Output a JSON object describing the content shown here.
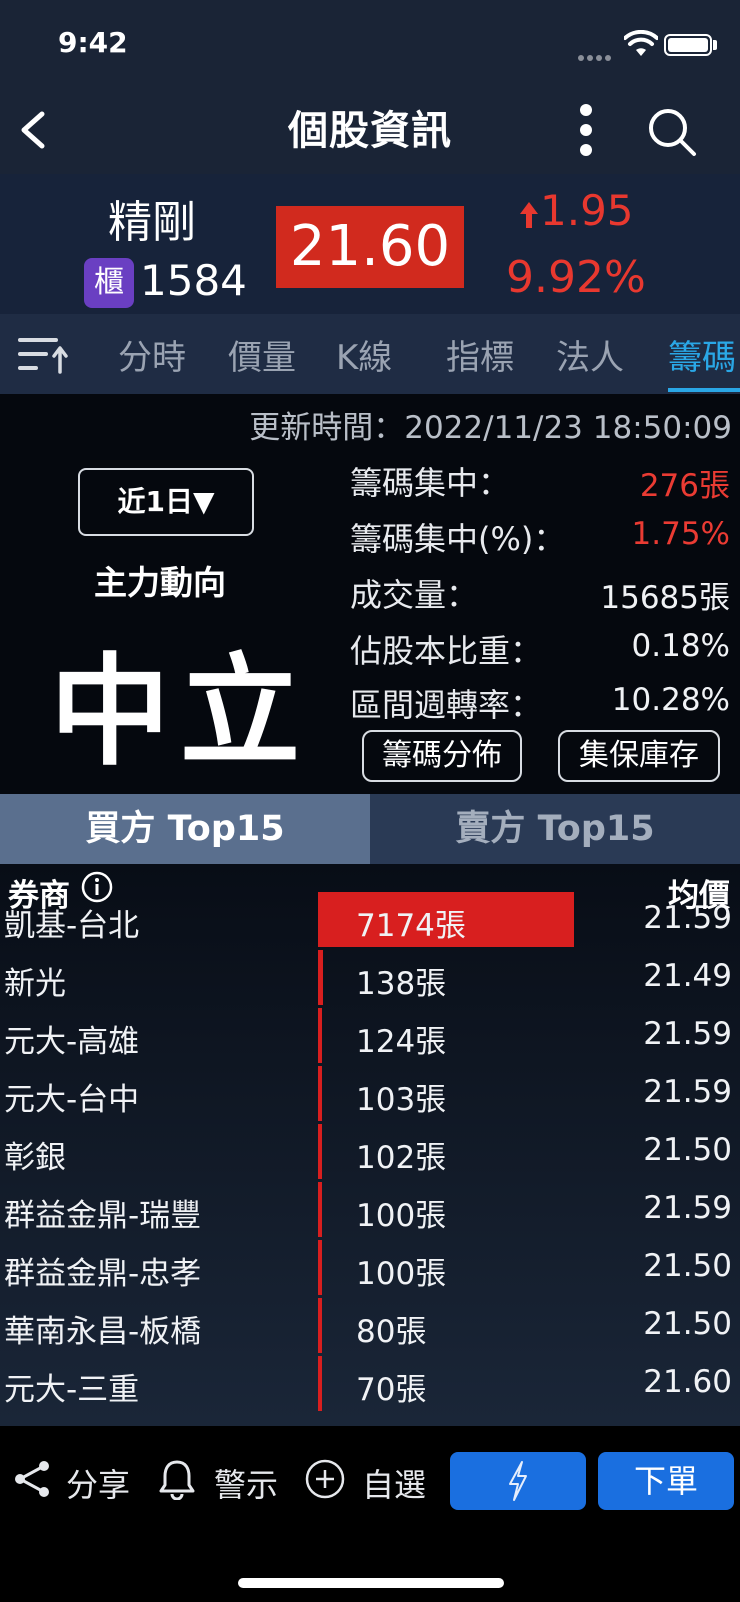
{
  "status_bar": {
    "time": "9:42"
  },
  "nav": {
    "title": "個股資訊"
  },
  "quote": {
    "name": "精剛",
    "market_badge": "櫃",
    "code": "1584",
    "price": "21.60",
    "change": "1.95",
    "change_pct": "9.92%",
    "up_color": "#e8382f"
  },
  "tabs": [
    "分時",
    "價量",
    "K線",
    "指標",
    "法人",
    "籌碼"
  ],
  "active_tab": "籌碼",
  "chip": {
    "update_time": "更新時間：2022/11/23 18:50:09",
    "period": "近1日▼",
    "main_force_label": "主力動向",
    "main_force_value": "中立",
    "stats": [
      {
        "label": "籌碼集中：",
        "value": "276張"
      },
      {
        "label": "籌碼集中(%)：",
        "value": "1.75%"
      },
      {
        "label": "成交量：",
        "value": "15685張"
      },
      {
        "label": "佔股本比重：",
        "value": "0.18%"
      },
      {
        "label": "區間週轉率：",
        "value": "10.28%"
      }
    ],
    "buttons": {
      "distribution": "籌碼分佈",
      "custody": "集保庫存"
    }
  },
  "buy_sell_tabs": {
    "buy": "買方 Top15",
    "sell": "賣方 Top15"
  },
  "table": {
    "col_broker": "券商",
    "col_avg": "均價",
    "rows": [
      {
        "broker": "凱基-台北",
        "volume": "7174張",
        "volume_num": 7174,
        "avg": "21.59"
      },
      {
        "broker": "新光",
        "volume": "138張",
        "volume_num": 138,
        "avg": "21.49"
      },
      {
        "broker": "元大-高雄",
        "volume": "124張",
        "volume_num": 124,
        "avg": "21.59"
      },
      {
        "broker": "元大-台中",
        "volume": "103張",
        "volume_num": 103,
        "avg": "21.59"
      },
      {
        "broker": "彰銀",
        "volume": "102張",
        "volume_num": 102,
        "avg": "21.50"
      },
      {
        "broker": "群益金鼎-瑞豐",
        "volume": "100張",
        "volume_num": 100,
        "avg": "21.59"
      },
      {
        "broker": "群益金鼎-忠孝",
        "volume": "100張",
        "volume_num": 100,
        "avg": "21.50"
      },
      {
        "broker": "華南永昌-板橋",
        "volume": "80張",
        "volume_num": 80,
        "avg": "21.50"
      },
      {
        "broker": "元大-三重",
        "volume": "70張",
        "volume_num": 70,
        "avg": "21.60"
      }
    ]
  },
  "toolbar": {
    "share": "分享",
    "alert": "警示",
    "watchlist": "自選",
    "order": "下單"
  }
}
